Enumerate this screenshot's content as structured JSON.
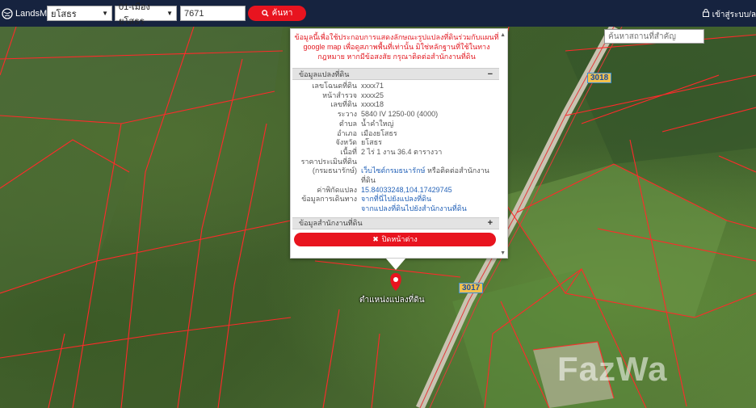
{
  "app": {
    "name": "LandsMaps"
  },
  "navbar": {
    "province_select": "ยโสธร",
    "district_select": "01-เมืองยโสธร",
    "parcel_input_value": "7671",
    "search_button_label": "ค้นหา",
    "login_label": "เข้าสู่ระบบ/ล"
  },
  "map": {
    "search_placeholder": "ค้นหาสถานที่สำคัญ",
    "road_badges": [
      "3018",
      "3017"
    ],
    "pin_label": "ตำแหน่งแปลงที่ดิน",
    "watermark": "FazWa"
  },
  "popup": {
    "disclaimer": "ข้อมูลนี้เพื่อใช้ประกอบการแสดงลักษณะรูปแปลงที่ดินร่วมกับแผนที่ google map เพื่อดูสภาพพื้นที่เท่านั้น มิใช่หลักฐานที่ใช้ในทางกฎหมาย หากมีข้อสงสัย กรุณาติดต่อสำนักงานที่ดิน",
    "section_land": "ข้อมูลแปลงที่ดิน",
    "section_land_toggle": "−",
    "section_office": "ข้อมูลสำนักงานที่ดิน",
    "section_office_toggle": "+",
    "close_button": "ปิดหน้าต่าง",
    "rows": [
      {
        "label": "เลขโฉนดที่ดิน",
        "value": "xxxx71"
      },
      {
        "label": "หน้าสำรวจ",
        "value": "xxxx25"
      },
      {
        "label": "เลขที่ดิน",
        "value": "xxxx18"
      },
      {
        "label": "ระวาง",
        "value": "5840 IV 1250-00 (4000)"
      },
      {
        "label": "ตำบล",
        "value": "น้ำคำใหญ่"
      },
      {
        "label": "อำเภอ",
        "value": "เมืองยโสธร"
      },
      {
        "label": "จังหวัด",
        "value": "ยโสธร"
      },
      {
        "label": "เนื้อที่",
        "value": "2 ไร่ 1 งาน 36.4 ตารางวา"
      }
    ],
    "price_label_1": "ราคาประเมินที่ดิน",
    "price_label_2": "(กรมธนารักษ์)",
    "price_link": "เว็บไซต์กรมธนารักษ์",
    "price_suffix": " หรือติดต่อสำนักงานที่ดิน",
    "coord_label": "ค่าพิกัดแปลง",
    "coord_value": "15.84033248,104.17429745",
    "travel_label": "ข้อมูลการเดินทาง",
    "travel_link_1": "จากที่นี่ไปยังแปลงที่ดิน",
    "travel_link_2": "จากแปลงที่ดินไปยังสำนักงานที่ดิน"
  }
}
